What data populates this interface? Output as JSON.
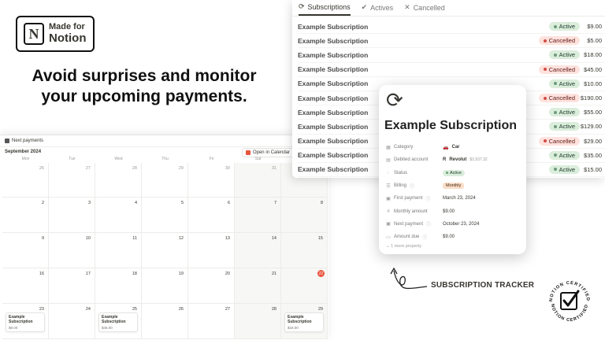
{
  "badge": {
    "line1": "Made for",
    "line2": "Notion",
    "logo_letter": "N"
  },
  "headline": {
    "line1": "Avoid surprises and monitor",
    "line2": "your upcoming payments."
  },
  "calendar": {
    "tab_label": "Next payments",
    "month": "September 2024",
    "open_button": "Open in Calendar",
    "weekdays": [
      "Mon",
      "Tue",
      "Wed",
      "Thu",
      "Fri",
      "Sat",
      "Sun"
    ],
    "weeks": [
      [
        "26",
        "27",
        "28",
        "29",
        "30",
        "31",
        "1"
      ],
      [
        "2",
        "3",
        "4",
        "5",
        "6",
        "7",
        "8"
      ],
      [
        "9",
        "10",
        "11",
        "12",
        "13",
        "14",
        "15"
      ],
      [
        "16",
        "17",
        "18",
        "19",
        "20",
        "21",
        "22"
      ],
      [
        "23",
        "24",
        "25",
        "26",
        "27",
        "28",
        "29"
      ]
    ],
    "today": "22",
    "events": [
      {
        "title": "Example Subscription",
        "amount": "$9.00"
      },
      {
        "title": "Example Subscription",
        "amount": "$45.00"
      },
      {
        "title": "Example Subscription",
        "amount": "$18.00"
      }
    ]
  },
  "list": {
    "tabs": [
      {
        "icon": "⟳",
        "label": "Subscriptions"
      },
      {
        "icon": "✔",
        "label": "Actives"
      },
      {
        "icon": "✕",
        "label": "Cancelled"
      }
    ],
    "rows": [
      {
        "name": "Example Subscription",
        "status": "Active",
        "amount": "$9.00"
      },
      {
        "name": "Example Subscription",
        "status": "Cancelled",
        "amount": "$5.00"
      },
      {
        "name": "Example Subscription",
        "status": "Active",
        "amount": "$18.00"
      },
      {
        "name": "Example Subscription",
        "status": "Cancelled",
        "amount": "$45.00"
      },
      {
        "name": "Example Subscription",
        "status": "Active",
        "amount": "$10.00"
      },
      {
        "name": "Example Subscription",
        "status": "Cancelled",
        "amount": "$190.00"
      },
      {
        "name": "Example Subscription",
        "status": "Active",
        "amount": "$55.00"
      },
      {
        "name": "Example Subscription",
        "status": "Active",
        "amount": "$129.00"
      },
      {
        "name": "Example Subscription",
        "status": "Cancelled",
        "amount": "$29.00"
      },
      {
        "name": "Example Subscription",
        "status": "Active",
        "amount": "$35.00"
      },
      {
        "name": "Example Subscription",
        "status": "Active",
        "amount": "$15.00"
      }
    ]
  },
  "card": {
    "icon": "⟳",
    "title": "Example Subscription",
    "props": {
      "category_label": "Category",
      "category_value": "Car",
      "account_label": "Debited account",
      "account_value": "Revolut",
      "account_balance": "$2,937.32",
      "status_label": "Status",
      "status_value": "Active",
      "billing_label": "Billing",
      "billing_value": "Monthly",
      "first_label": "First payment",
      "first_value": "March 23, 2024",
      "monthly_label": "Monthly amount",
      "monthly_value": "$9.00",
      "next_label": "Next payment",
      "next_value": "October 23, 2024",
      "due_label": "Amount due",
      "due_value": "$9.00"
    },
    "more": "1 more property"
  },
  "tracker_label": "SUBSCRIPTION TRACKER",
  "seal": {
    "text_top": "NOTION CERTIFIED",
    "text_bottom": "NOTION CERTIFIED"
  },
  "colors": {
    "today": "#e8553e",
    "active_bg": "#dbeddb",
    "cancelled_bg": "#ffe2dd",
    "monthly_bg": "#fadec9"
  }
}
